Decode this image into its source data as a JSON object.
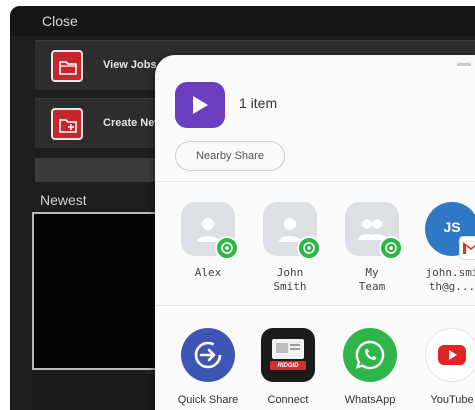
{
  "background_app": {
    "close_label": "Close",
    "menu": [
      {
        "label": "View Jobs",
        "icon": "folder-icon"
      },
      {
        "label": "Create New",
        "icon": "folder-plus-icon"
      }
    ],
    "section_label": "Newest"
  },
  "share_sheet": {
    "item_count": "1 item",
    "nearby_share_label": "Nearby Share",
    "contacts": [
      {
        "name": "Alex",
        "badge": "whatsapp-icon"
      },
      {
        "name": "John\nSmith",
        "badge": "whatsapp-icon"
      },
      {
        "name": "My\nTeam",
        "badge": "whatsapp-icon"
      },
      {
        "name": "john.smi\nth@g...",
        "initials": "JS",
        "badge": "gmail-icon"
      }
    ],
    "apps": [
      {
        "name": "Quick Share",
        "icon": "quick-share-icon"
      },
      {
        "name": "Connect",
        "icon": "ridgid-connect-icon",
        "icon_text": "RIDGID"
      },
      {
        "name": "WhatsApp",
        "icon": "whatsapp-icon"
      },
      {
        "name": "YouTube",
        "icon": "youtube-icon"
      }
    ]
  },
  "colors": {
    "accent_purple": "#6a3fbf",
    "brand_red": "#c4272e",
    "whatsapp_green": "#2fb54a",
    "quick_share_blue": "#3f55b5",
    "youtube_red": "#e02525"
  }
}
